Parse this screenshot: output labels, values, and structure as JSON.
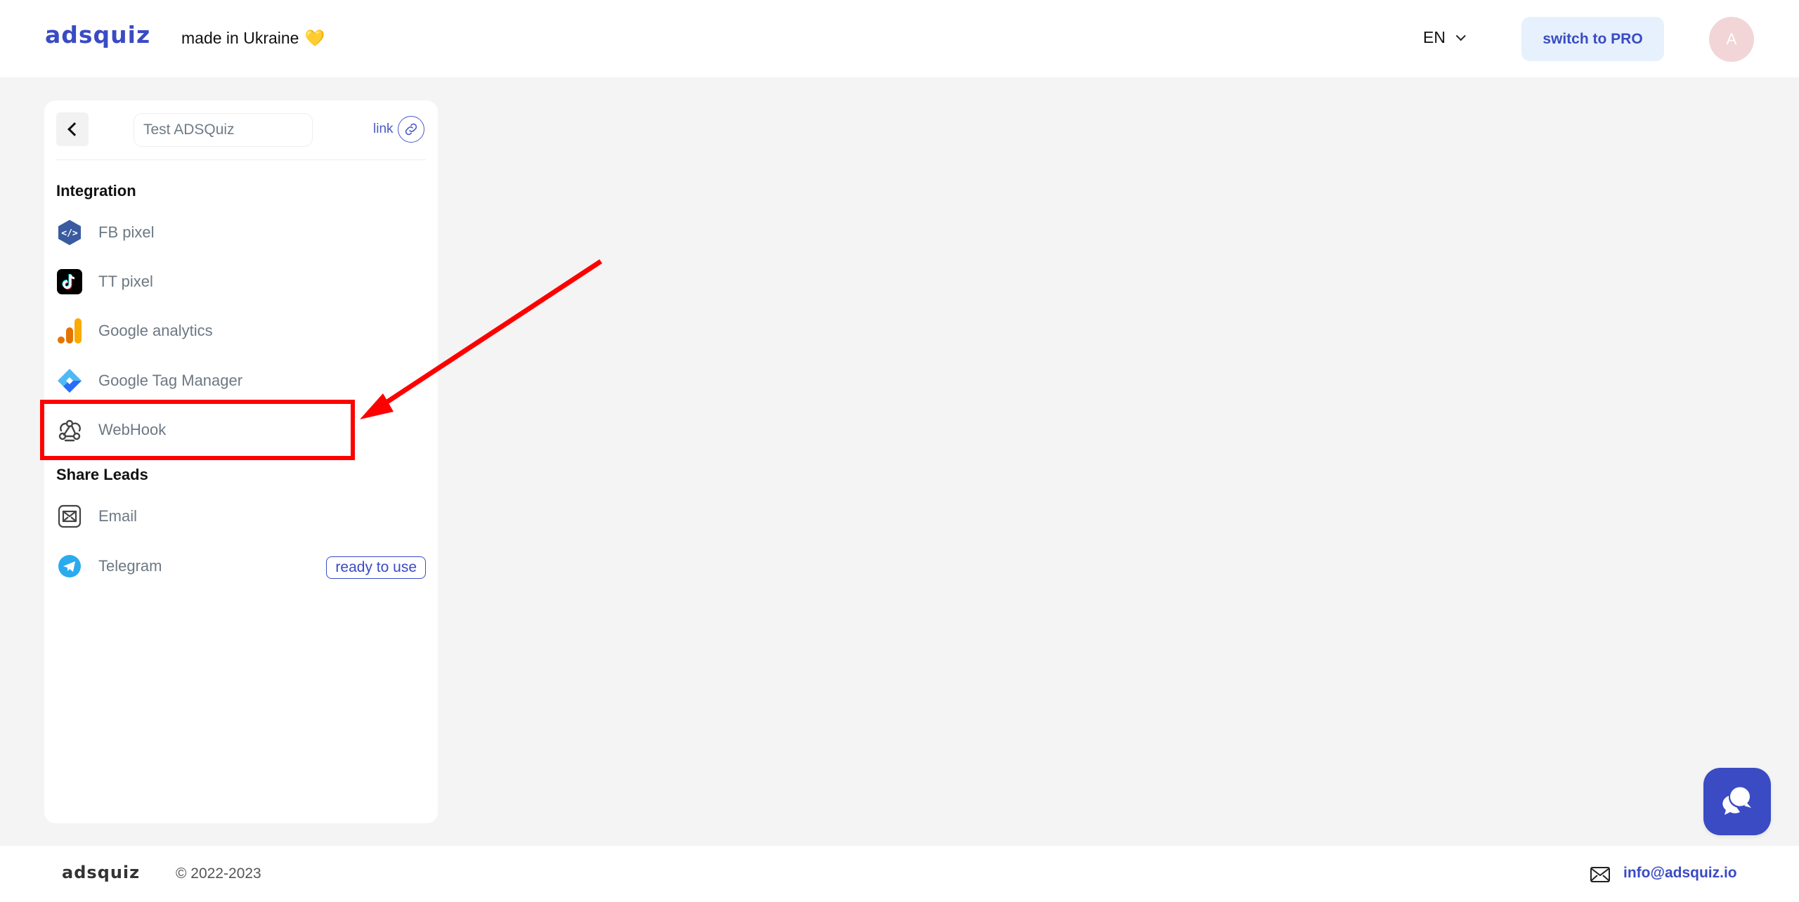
{
  "header": {
    "logo": "adsquiz",
    "tagline": "made in Ukraine",
    "tagline_emoji": "💛",
    "language": "EN",
    "pro_button": "switch to PRO",
    "avatar_initial": "A"
  },
  "sidebar": {
    "quiz_name": "Test ADSQuiz",
    "link_label": "link",
    "sections": [
      {
        "title": "Integration",
        "items": [
          {
            "label": "FB pixel",
            "icon": "code-hexagon-icon"
          },
          {
            "label": "TT pixel",
            "icon": "tiktok-icon"
          },
          {
            "label": "Google analytics",
            "icon": "google-analytics-icon"
          },
          {
            "label": "Google Tag Manager",
            "icon": "google-tag-manager-icon"
          },
          {
            "label": "WebHook",
            "icon": "webhook-icon"
          }
        ]
      },
      {
        "title": "Share Leads",
        "items": [
          {
            "label": "Email",
            "icon": "envelope-icon"
          },
          {
            "label": "Telegram",
            "icon": "telegram-icon",
            "badge": "ready to use"
          }
        ]
      }
    ]
  },
  "annotation": {
    "highlighted_item": "WebHook",
    "color": "#ff0000"
  },
  "footer": {
    "logo": "adsquiz",
    "copyright": "© 2022-2023",
    "email": "info@adsquiz.io"
  },
  "colors": {
    "brand": "#3a4bc4",
    "pro_bg": "#e6f1fd",
    "avatar_bg": "#f2d5d7",
    "page_bg": "#f4f4f4"
  }
}
